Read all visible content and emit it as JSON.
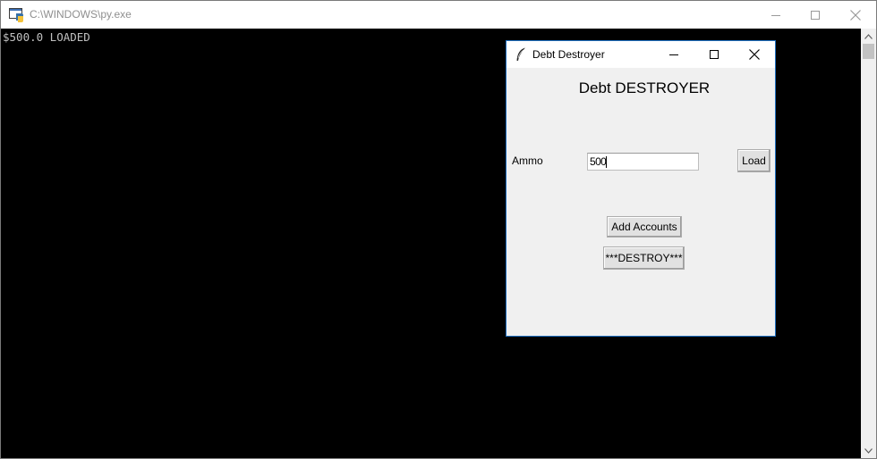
{
  "console": {
    "title": "C:\\WINDOWS\\py.exe",
    "output": "$500.0 LOADED",
    "icons": {
      "app": "python-console-icon",
      "minimize": "minimize-icon",
      "maximize": "maximize-icon",
      "close": "close-icon"
    }
  },
  "dialog": {
    "title": "Debt Destroyer",
    "heading": "Debt DESTROYER",
    "ammo_label": "Ammo",
    "ammo_value": "500",
    "load_label": "Load",
    "add_accounts_label": "Add Accounts",
    "destroy_label": "***DESTROY***",
    "icons": {
      "app": "tk-feather-icon",
      "minimize": "minimize-icon",
      "maximize": "maximize-icon",
      "close": "close-icon"
    }
  },
  "colors": {
    "console_bg": "#000000",
    "console_text": "#c0c0c0",
    "dialog_bg": "#f0f0f0",
    "dialog_border": "#1f6fc0",
    "button_bg": "#e1e1e1"
  }
}
